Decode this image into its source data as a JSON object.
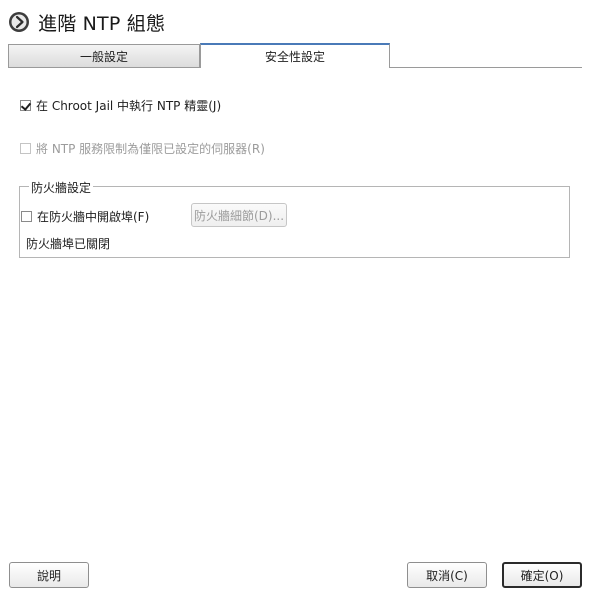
{
  "window": {
    "title": "進階 NTP 組態"
  },
  "tabs": [
    {
      "label": "一般設定",
      "active": false
    },
    {
      "label": "安全性設定",
      "active": true
    }
  ],
  "options": {
    "chroot": {
      "label": "在 Chroot Jail 中執行 NTP 精靈(J)",
      "checked": true,
      "enabled": true
    },
    "restrict": {
      "label": "將 NTP 服務限制為僅限已設定的伺服器(R)",
      "checked": false,
      "enabled": false
    }
  },
  "firewall": {
    "group_title": "防火牆設定",
    "open_port_label": "在防火牆中開啟埠(F)",
    "open_port_checked": false,
    "details_button": "防火牆細節(D)...",
    "status": "防火牆埠已關閉"
  },
  "footer": {
    "help": "說明",
    "cancel": "取消(C)",
    "ok": "確定(O)"
  },
  "colors": {
    "active_tab_accent": "#4a7ab8"
  }
}
